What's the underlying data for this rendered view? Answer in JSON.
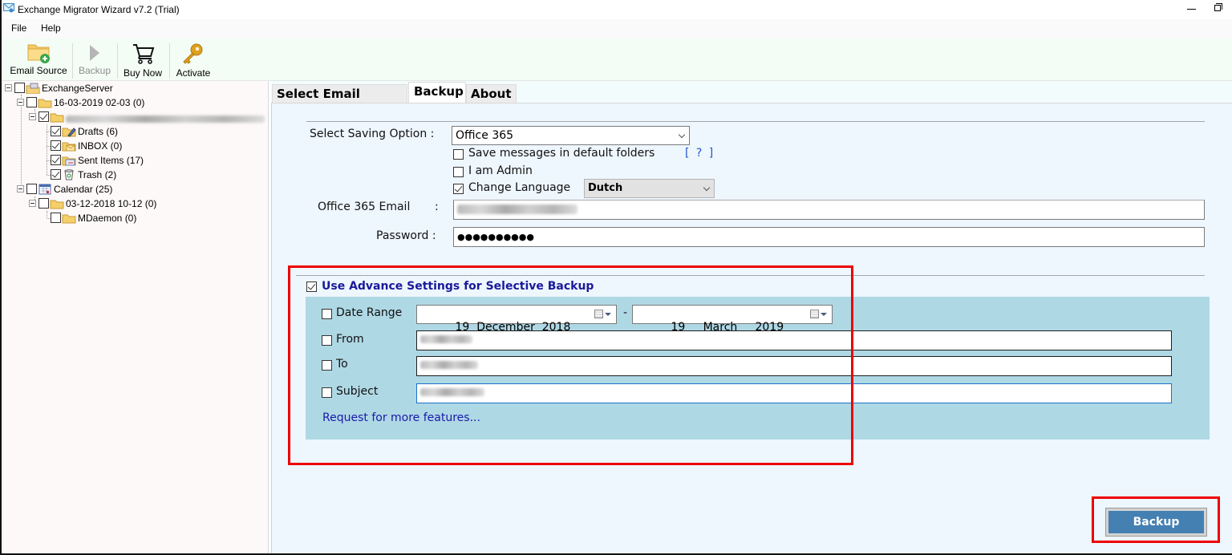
{
  "window": {
    "title": "Exchange Migrator Wizard v7.2 (Trial)",
    "controls": [
      "minimize",
      "restore"
    ]
  },
  "menu": [
    {
      "label": "File"
    },
    {
      "label": "Help"
    }
  ],
  "toolbar": [
    {
      "label": "Email Source",
      "icon": "folder-add-icon",
      "enabled": true
    },
    {
      "label": "Backup",
      "icon": "play-icon",
      "enabled": false
    },
    {
      "label": "Buy Now",
      "icon": "cart-icon",
      "enabled": true
    },
    {
      "label": "Activate",
      "icon": "key-icon",
      "enabled": true
    }
  ],
  "tree": {
    "root": {
      "label": "ExchangeServer",
      "checked": false
    },
    "nodes": [
      {
        "label": "16-03-2019 02-03 (0)",
        "checked": false
      },
      {
        "label": "[blurred email account]",
        "checked": true
      },
      {
        "label": "Drafts (6)",
        "checked": true,
        "icon": "drafts-folder-icon"
      },
      {
        "label": "INBOX (0)",
        "checked": true,
        "icon": "inbox-folder-icon"
      },
      {
        "label": "Sent Items (17)",
        "checked": true,
        "icon": "sent-folder-icon"
      },
      {
        "label": "Trash (2)",
        "checked": true,
        "icon": "trash-icon"
      },
      {
        "label": "Calendar (25)",
        "checked": false,
        "icon": "calendar-icon"
      },
      {
        "label": "03-12-2018 10-12 (0)",
        "checked": false
      },
      {
        "label": "MDaemon (0)",
        "checked": false
      }
    ]
  },
  "tabs": [
    {
      "label": "Select Email Source",
      "active": false
    },
    {
      "label": "Backup",
      "active": true
    },
    {
      "label": "About",
      "active": false
    }
  ],
  "backup": {
    "saving_option_label": "Select Saving Option :",
    "saving_option_value": "Office 365",
    "save_default_folders": {
      "label": "Save messages in default folders",
      "checked": false
    },
    "help_link": "[ ? ]",
    "i_am_admin": {
      "label": "I am Admin",
      "checked": false
    },
    "change_language": {
      "label": "Change Language",
      "checked": true,
      "value": "Dutch"
    },
    "email_label": "Office 365 Email",
    "email_colon": ":",
    "email_value": "",
    "password_label": "Password :",
    "password_value": "●●●●●●●●●●"
  },
  "advanced": {
    "title": "Use Advance Settings for Selective Backup",
    "checked": true,
    "date_range": {
      "label": "Date Range",
      "checked": false,
      "from": "19  December  2018",
      "separator": "-",
      "to": "19     March     2019"
    },
    "from": {
      "label": "From",
      "checked": false,
      "value": ""
    },
    "to": {
      "label": "To",
      "checked": false,
      "value": ""
    },
    "subject": {
      "label": "Subject",
      "checked": false,
      "value": ""
    },
    "more_link": "Request for more features..."
  },
  "actions": {
    "backup_label": "Backup"
  },
  "colors": {
    "highlight": "#ee0000",
    "button": "#4480b2",
    "advanced_panel": "#afd8e5",
    "link": "#1a1aaa"
  }
}
